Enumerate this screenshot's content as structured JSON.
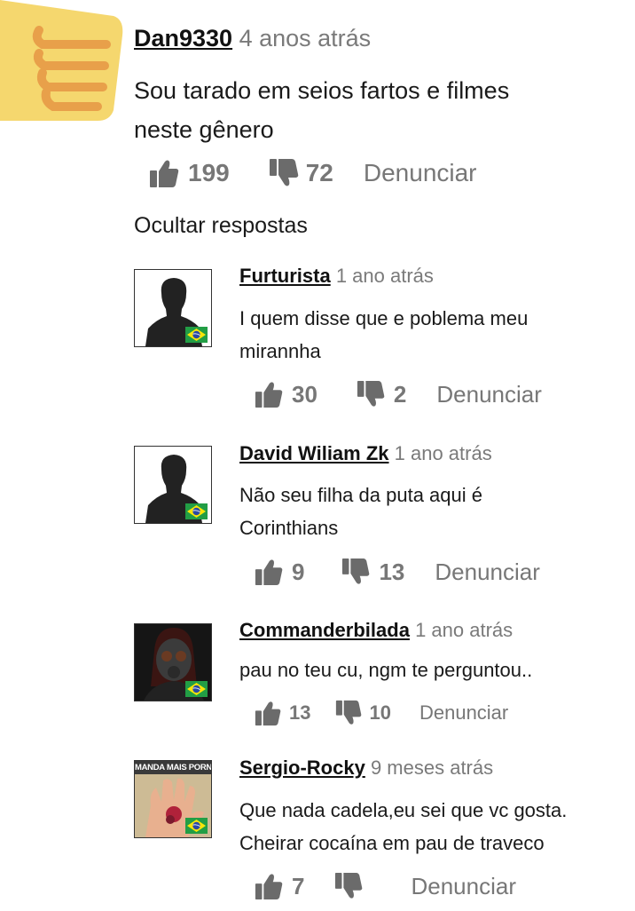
{
  "main_comment": {
    "username": "Dan9330",
    "time": "4 anos atrás",
    "text_line1": "Sou tarado em seios fartos e filmes",
    "text_line2": "neste gênero",
    "likes": "199",
    "dislikes": "72",
    "report": "Denunciar",
    "hide_replies": "Ocultar respostas"
  },
  "replies": [
    {
      "username": "Furturista",
      "time": "1 ano atrás",
      "text_line1": "I quem disse que e poblema meu",
      "text_line2": "mirannha",
      "likes": "30",
      "dislikes": "2",
      "report": "Denunciar",
      "avatar": "default-silhouette"
    },
    {
      "username": "David Wiliam Zk",
      "time": "1 ano atrás",
      "text_line1": "Não seu filha da puta aqui é",
      "text_line2": "Corinthians",
      "likes": "9",
      "dislikes": "13",
      "report": "Denunciar",
      "avatar": "default-silhouette"
    },
    {
      "username": "Commanderbilada",
      "time": "1 ano atrás",
      "text_line1": "pau no teu cu, ngm te perguntou..",
      "likes": "13",
      "dislikes": "10",
      "report": "Denunciar",
      "avatar": "gas-mask-photo"
    },
    {
      "username": "Sergio-Rocky",
      "time": "9 meses atrás",
      "text_line1": "Que nada cadela,eu sei que vc gosta.",
      "text_line2": "Cheirar cocaína em pau de traveco",
      "likes": "7",
      "dislikes": "",
      "report": "Denunciar",
      "avatar": "injured-hand-photo",
      "avatar_caption": "MANDA MAIS PORN"
    }
  ],
  "colors": {
    "thumb_badge": "#f5d76e",
    "thumb_stripes": "#e8a04a",
    "icon_gray": "#6b6b6b",
    "meta_gray": "#7a7a7a"
  }
}
